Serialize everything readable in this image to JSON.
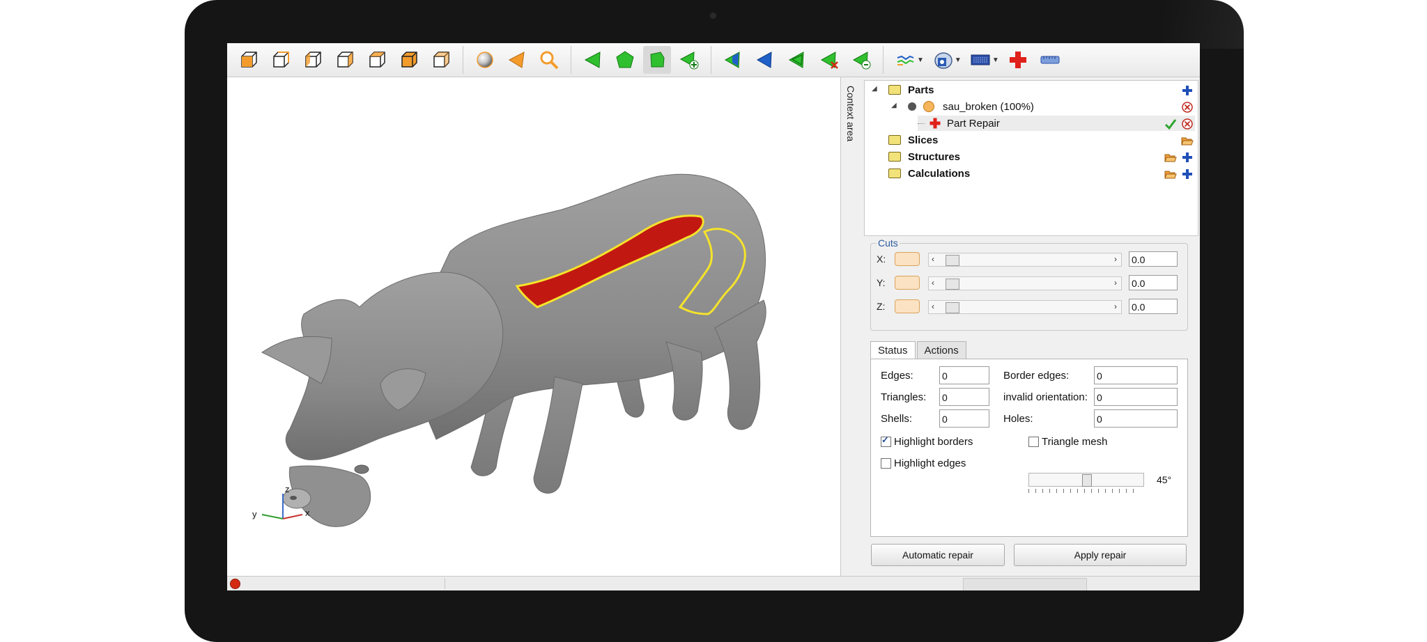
{
  "app": {
    "toolbar": {
      "view_icons": [
        "view-front-icon",
        "view-back-icon",
        "view-left-icon",
        "view-right-icon",
        "view-top-icon",
        "view-bottom-icon",
        "view-iso-icon"
      ],
      "render_icons": [
        "sphere-shading-icon",
        "triangle-select-icon",
        "zoom-icon"
      ],
      "select_icons": [
        "select-triangle-icon",
        "select-surface-icon",
        "select-shell-icon",
        "add-selection-icon"
      ],
      "mark_icons": [
        "mark-icon-1",
        "mark-icon-2",
        "mark-icon-3",
        "mark-icon-4",
        "mark-icon-5"
      ],
      "tool_icons": [
        "network-icon",
        "disk-icon",
        "keyboard-icon",
        "part-repair-icon",
        "ruler-icon"
      ]
    },
    "context_label": "Context area",
    "axes": {
      "x": "x",
      "y": "y",
      "z": "z"
    },
    "tree": {
      "parts": "Parts",
      "part_name": "sau_broken (100%)",
      "part_repair": "Part Repair",
      "slices": "Slices",
      "structures": "Structures",
      "calculations": "Calculations"
    },
    "cuts": {
      "title": "Cuts",
      "rows": [
        {
          "label": "X:",
          "value": "0.0"
        },
        {
          "label": "Y:",
          "value": "0.0"
        },
        {
          "label": "Z:",
          "value": "0.0"
        }
      ]
    },
    "tabs": {
      "status": "Status",
      "actions": "Actions"
    },
    "status": {
      "edges_label": "Edges:",
      "edges": "0",
      "triangles_label": "Triangles:",
      "triangles": "0",
      "shells_label": "Shells:",
      "shells": "0",
      "border_edges_label": "Border edges:",
      "border_edges": "0",
      "invalid_orientation_label": "invalid orientation:",
      "invalid_orientation": "0",
      "holes_label": "Holes:",
      "holes": "0",
      "highlight_borders": "Highlight borders",
      "highlight_borders_checked": true,
      "triangle_mesh": "Triangle mesh",
      "highlight_edges": "Highlight edges",
      "angle": "45°"
    },
    "buttons": {
      "automatic_repair": "Automatic repair",
      "apply_repair": "Apply repair"
    },
    "colors": {
      "accent_orange": "#f0a03a",
      "highlight_red": "#c21812",
      "border_yellow": "#f5e32b",
      "model_gray": "#8c8c8c"
    }
  }
}
